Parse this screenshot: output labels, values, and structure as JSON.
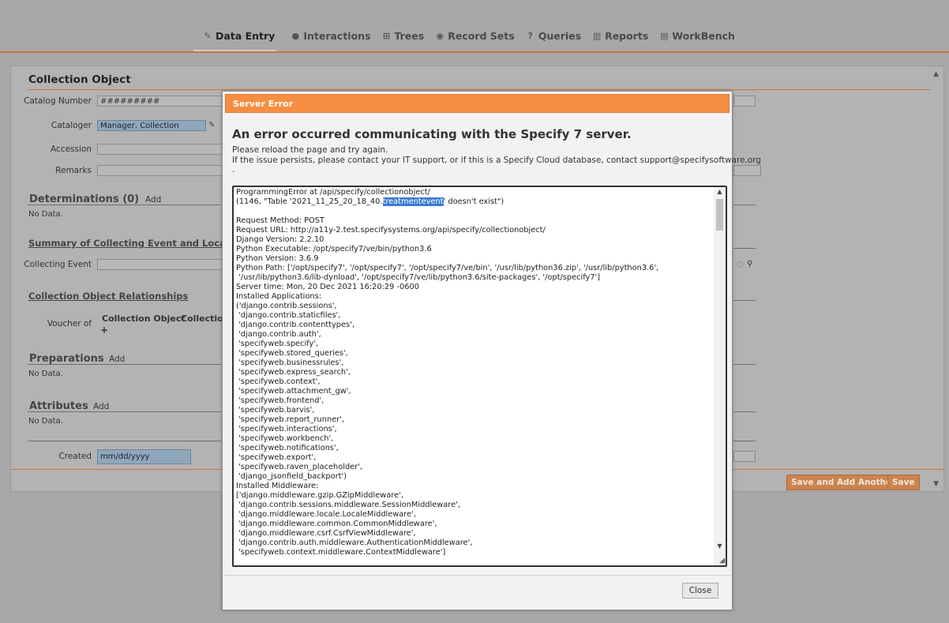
{
  "nav": {
    "tabs": [
      {
        "label": "Data Entry",
        "icon": "pencil-icon"
      },
      {
        "label": "Interactions",
        "icon": "chat-icon"
      },
      {
        "label": "Trees",
        "icon": "tree-icon"
      },
      {
        "label": "Record Sets",
        "icon": "disc-icon"
      },
      {
        "label": "Queries",
        "icon": "question-icon"
      },
      {
        "label": "Reports",
        "icon": "book-icon"
      },
      {
        "label": "WorkBench",
        "icon": "workbench-icon"
      }
    ]
  },
  "form": {
    "title": "Collection Object",
    "catalog_number_label": "Catalog Number",
    "catalog_number_value": "#########",
    "cataloger_label": "Cataloger",
    "cataloger_value": "Manager, Collection",
    "accession_label": "Accession",
    "remarks_label": "Remarks",
    "determinations": "Determinations (0)",
    "determinations_add": "Add",
    "no_data": "No Data.",
    "summary": "Summary of Collecting Event and Local",
    "collecting_event_label": "Collecting Event",
    "relationships": "Collection Object Relationships",
    "voucher_label": "Voucher of",
    "voucher_col1": "Collection Object",
    "voucher_col2": "Collection",
    "plus": "+",
    "preparations": "Preparations",
    "preparations_add": "Add",
    "attributes": "Attributes",
    "attributes_add": "Add",
    "created_label": "Created",
    "created_placeholder": "mm/dd/yyyy",
    "save_add_another": "Save and Add Another",
    "save": "Save"
  },
  "dialog": {
    "header": "Server Error",
    "heading": "An error occurred communicating with the Specify 7 server.",
    "line1": "Please reload the page and try again.",
    "line2": "If the issue persists, please contact your IT support, or if this is a Specify Cloud database, contact support@specifysoftware.org",
    "line3": ".",
    "error_before_hl": "ProgrammingError at /api/specify/collectionobject/\n(1146, \"Table '2021_11_25_20_18_40.",
    "error_hl": "treatmentevent",
    "error_after_hl": "' doesn't exist\")\n\nRequest Method: POST\nRequest URL: http://a11y-2.test.specifysystems.org/api/specify/collectionobject/\nDjango Version: 2.2.10\nPython Executable: /opt/specify7/ve/bin/python3.6\nPython Version: 3.6.9\nPython Path: ['/opt/specify7', '/opt/specify7', '/opt/specify7/ve/bin', '/usr/lib/python36.zip', '/usr/lib/python3.6',\n '/usr/lib/python3.6/lib-dynload', '/opt/specify7/ve/lib/python3.6/site-packages', '/opt/specify7']\nServer time: Mon, 20 Dec 2021 16:20:29 -0600\nInstalled Applications:\n('django.contrib.sessions',\n 'django.contrib.staticfiles',\n 'django.contrib.contenttypes',\n 'django.contrib.auth',\n 'specifyweb.specify',\n 'specifyweb.stored_queries',\n 'specifyweb.businessrules',\n 'specifyweb.express_search',\n 'specifyweb.context',\n 'specifyweb.attachment_gw',\n 'specifyweb.frontend',\n 'specifyweb.barvis',\n 'specifyweb.report_runner',\n 'specifyweb.interactions',\n 'specifyweb.workbench',\n 'specifyweb.notifications',\n 'specifyweb.export',\n 'specifyweb.raven_placeholder',\n 'django_jsonfield_backport')\nInstalled Middleware:\n['django.middleware.gzip.GZipMiddleware',\n 'django.contrib.sessions.middleware.SessionMiddleware',\n 'django.middleware.locale.LocaleMiddleware',\n 'django.middleware.common.CommonMiddleware',\n 'django.middleware.csrf.CsrfViewMiddleware',\n 'django.contrib.auth.middleware.AuthenticationMiddleware',\n 'specifyweb.context.middleware.ContextMiddleware']",
    "close": "Close"
  },
  "colors": {
    "accent": "#f68e42",
    "overlay": "#a8a8a8",
    "selection": "#3a7bd5"
  }
}
